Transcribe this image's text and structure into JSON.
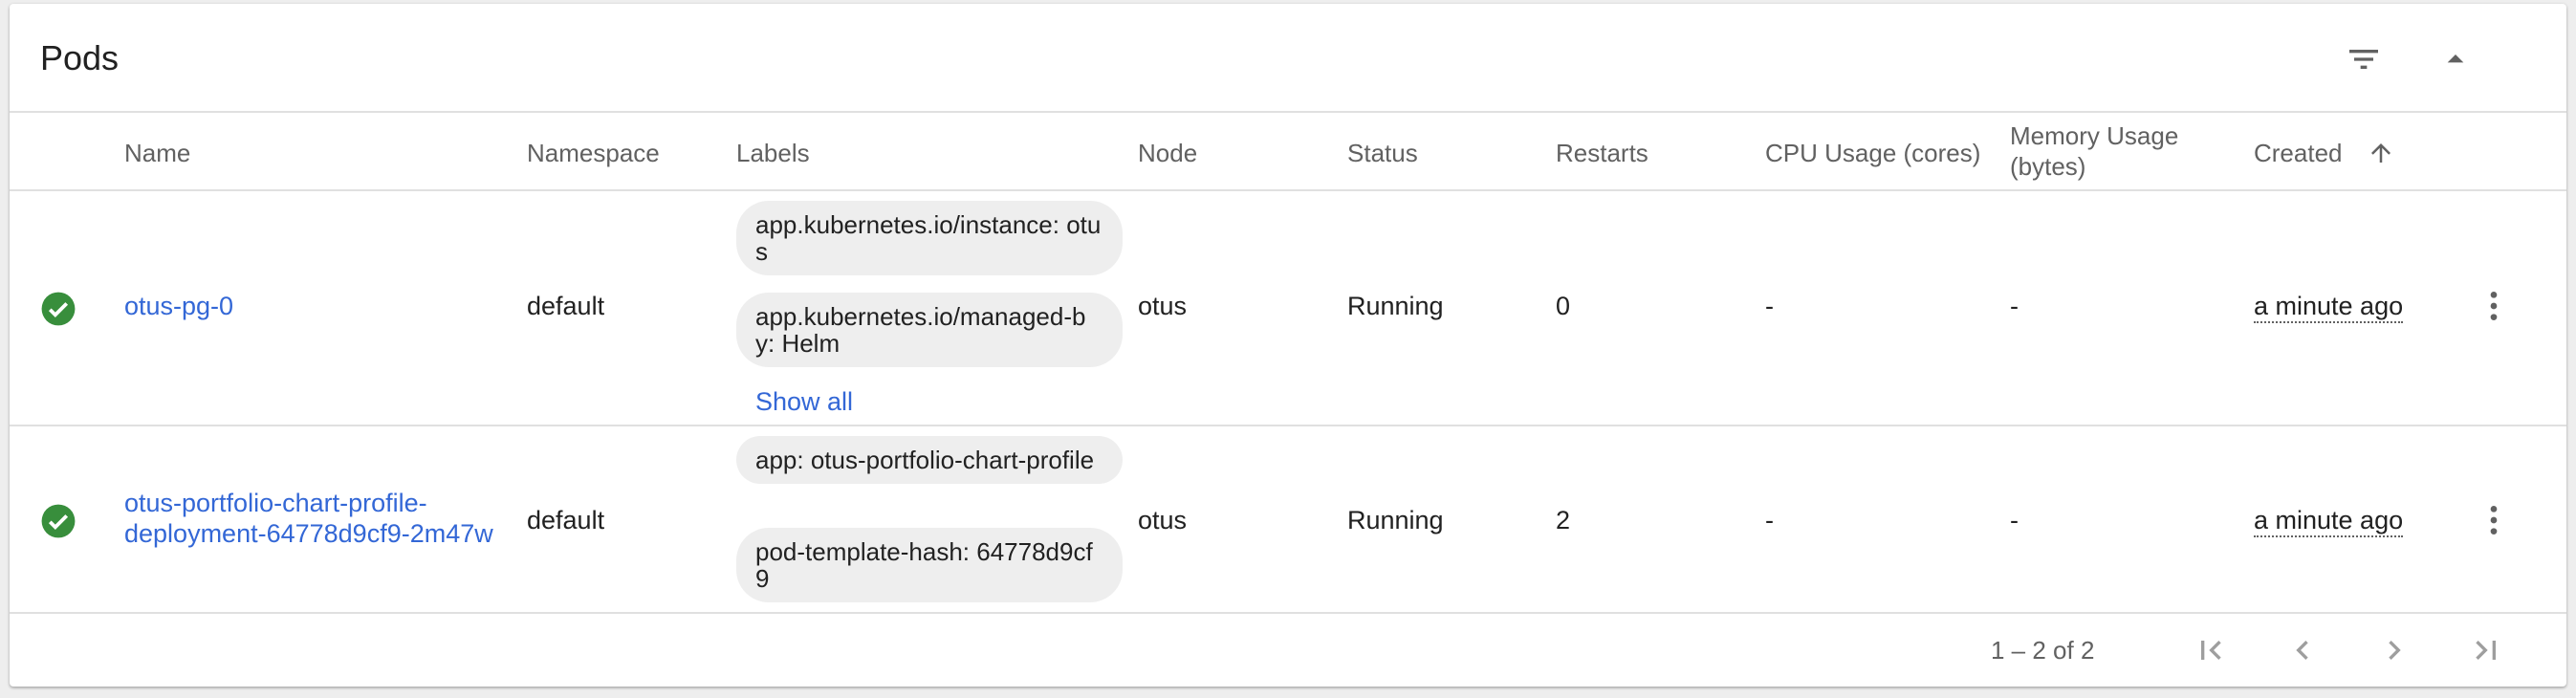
{
  "card": {
    "title": "Pods"
  },
  "header_icons": [
    "filter-icon",
    "collapse-icon"
  ],
  "columns": {
    "name": "Name",
    "namespace": "Namespace",
    "labels": "Labels",
    "node": "Node",
    "status": "Status",
    "restarts": "Restarts",
    "cpu": "CPU Usage (cores)",
    "memory": "Memory Usage (bytes)",
    "created": "Created"
  },
  "rows": [
    {
      "name": "otus-pg-0",
      "namespace": "default",
      "labels": [
        "app.kubernetes.io/instance: otus",
        "app.kubernetes.io/managed-by: Helm"
      ],
      "show_all": "Show all",
      "node": "otus",
      "status": "Running",
      "restarts": "0",
      "cpu": "-",
      "memory": "-",
      "created": "a minute ago"
    },
    {
      "name": "otus-portfolio-chart-profile-deployment-64778d9cf9-2m47w",
      "namespace": "default",
      "labels": [
        "app: otus-portfolio-chart-profile",
        "pod-template-hash: 64778d9cf9"
      ],
      "node": "otus",
      "status": "Running",
      "restarts": "2",
      "cpu": "-",
      "memory": "-",
      "created": "a minute ago"
    }
  ],
  "footer": {
    "range": "1 – 2 of 2"
  },
  "colors": {
    "accent": "#3367d6",
    "success": "#388e3c",
    "chip": "#eeeeee"
  }
}
